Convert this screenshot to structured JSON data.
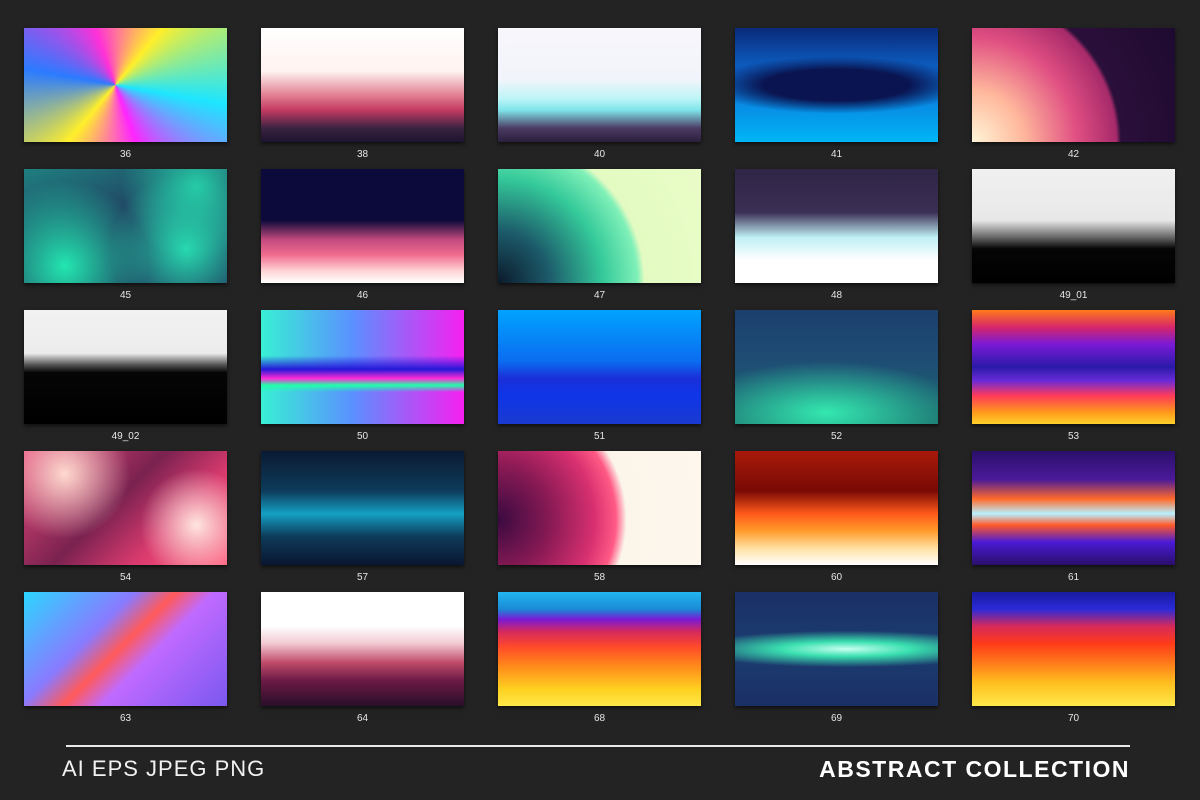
{
  "gallery": {
    "items": [
      {
        "label": "36",
        "bg": "conic-gradient(from 40deg at 45% 50%, #ffef2a, #1de6ff, #ff24ff, #ffef2a, #2b7bff, #ff30d8, #ffef2a)"
      },
      {
        "label": "38",
        "bg": "linear-gradient(180deg, #ffffff 0%, #fff3f0 38%, #e07a8e 60%, #c23a62 72%, #3a2340 88%, #1c1430 100%)"
      },
      {
        "label": "40",
        "bg": "linear-gradient(180deg, #f7f7fc 0%, #f2f4fb 45%, #bdf5f7 62%, #7fe4ea 72%, #4b3a62 88%, #2a1f3d 100%)"
      },
      {
        "label": "41",
        "bg": "radial-gradient(ellipse 65% 25% at 50% 50%, #0a1450 0%, #0a1450 55%, rgba(10,20,80,0) 100%), linear-gradient(180deg, #0a2a7a 0%, #0d6ed8 45%, #00b6f6 100%)"
      },
      {
        "label": "42",
        "bg": "radial-gradient(circle at 0% 100%, #fff6d8 0%, #ffb89c 22%, #e04f82 45%, #a72a6a 62%, #2a0f3a 64%, #1e0a30 100%)"
      },
      {
        "label": "45",
        "bg": "radial-gradient(circle at 20% 85%, #22e6b0 0%, rgba(34,230,176,0) 45%), radial-gradient(circle at 80% 70%, #27d9b0 0%, rgba(39,217,176,0) 42%), radial-gradient(circle at 85% 15%, #25c9a5 0%, rgba(37,201,165,0) 38%), linear-gradient(160deg, #1f7f80 0%, #213a5e 50%, #1e2a55 100%)"
      },
      {
        "label": "46",
        "bg": "linear-gradient(180deg, #0c0a3a 0%, #0c0a3a 45%, #c24a7e 62%, #f06a8e 75%, #ffd7d7 90%, #ffffff 100%)"
      },
      {
        "label": "47",
        "bg": "radial-gradient(circle at 0% 100%, #0b1a2a 0%, #1c5a6a 22%, #34c99a 45%, #7ff0b8 60%, #e3fbc2 63%, #eafcc8 100%)"
      },
      {
        "label": "48",
        "bg": "linear-gradient(180deg, #2f2545 0%, #3b2f55 38%, #bfeff5 60%, #ffffff 80%, #ffffff 100%)"
      },
      {
        "label": "49_01",
        "bg": "linear-gradient(180deg, #f0f0f0 0%, #e8e8e8 45%, #666666 60%, #050505 70%, #000000 100%)"
      },
      {
        "label": "49_02",
        "bg": "linear-gradient(180deg, #f2f2f2 0%, #ececec 38%, #555555 48%, #050505 55%, #000000 100%)"
      },
      {
        "label": "50",
        "bg": "linear-gradient(180deg, rgba(0,0,0,0) 0%, rgba(0,0,0,0) 40%, #2418d8 52%, #ff2bd6 60%, #22ffa8 66%, rgba(0,0,0,0) 72%), linear-gradient(90deg, #38f0d4 0%, #5a90ff 45%, #f71ff0 100%)"
      },
      {
        "label": "51",
        "bg": "linear-gradient(180deg, #01a3ff 0%, #0b6df0 45%, #1a2fd8 60%, #0f35e8 75%, #1a3ad0 100%)"
      },
      {
        "label": "52",
        "bg": "radial-gradient(ellipse 70% 45% at 45% 90%, #34e8b0 0%, rgba(52,232,176,0) 100%), linear-gradient(180deg, #1c3f6e 0%, #1e4f74 50%, #1a6a6a 100%)"
      },
      {
        "label": "53",
        "bg": "linear-gradient(180deg, #ff7a1a 0%, #d6276a 15%, #7b1ad6 30%, #2a1aa8 50%, #6a2ad8 62%, #ff3a5a 75%, #ff9a1a 90%, #ffd02a 100%)"
      },
      {
        "label": "54",
        "bg": "radial-gradient(circle at 20% 20%, #ffd9cf 0%, rgba(255,217,207,0) 35%), radial-gradient(circle at 85% 65%, #ffe5df 0%, rgba(255,229,223,0) 30%), linear-gradient(135deg, #e74a7a 0%, #7a2250 45%, #d93a6e 70%, #ff5a7a 100%)"
      },
      {
        "label": "57",
        "bg": "linear-gradient(180deg, #0b1a33 0%, #0d3b5a 35%, #14a0c4 55%, #0d3b5a 75%, #0a1630 100%)"
      },
      {
        "label": "58",
        "bg": "radial-gradient(circle at 0% 60%, #3a0a40 0%, #8a1a55 25%, #d83070 45%, #ff5a86 55%, #fbf5ea 60%, #fdf7ee 100%)"
      },
      {
        "label": "60",
        "bg": "linear-gradient(180deg, #a81a0a 0%, #7a0a05 35%, #ff5a1a 55%, #ff9a2a 70%, #ffe0a0 85%, #ffffff 100%)"
      },
      {
        "label": "61",
        "bg": "linear-gradient(180deg, #2a0f6a 0%, #4b1a9a 25%, #ff6a2a 42%, #b8f0ff 55%, #ff5a2a 65%, #4a1ad6 80%, #2a0f6a 100%)"
      },
      {
        "label": "63",
        "bg": "linear-gradient(135deg, #2bd6ff 0%, #8a7aff 35%, #ff5a5a 48%, #c06aff 60%, #7a58f0 100%)"
      },
      {
        "label": "64",
        "bg": "linear-gradient(180deg, #ffffff 0%, #ffffff 30%, #f2c9d2 45%, #c04a6a 62%, #6a1a45 78%, #2a0f2a 100%)"
      },
      {
        "label": "68",
        "bg": "linear-gradient(180deg, #22b6f0 0%, #1a8ad6 15%, #7a1ad6 24%, #d62a5a 35%, #ff4a2a 48%, #ff8a1a 65%, #ffd020 85%, #ffe84a 100%)"
      },
      {
        "label": "69",
        "bg": "radial-gradient(ellipse 80% 16% at 55% 50%, #c8fff0 0%, #3ae0b0 40%, rgba(58,224,176,0) 100%), linear-gradient(180deg, #1a2f66 0%, #1c3d70 50%, #1a2f66 100%)"
      },
      {
        "label": "70",
        "bg": "linear-gradient(180deg, #1a1aa0 0%, #2a2ad8 15%, #d62a5a 30%, #ff3a1a 45%, #ff7a1a 62%, #ffc020 80%, #ffe84a 100%)"
      }
    ]
  },
  "footer": {
    "formats": "AI EPS JPEG PNG",
    "title": "ABSTRACT COLLECTION"
  }
}
